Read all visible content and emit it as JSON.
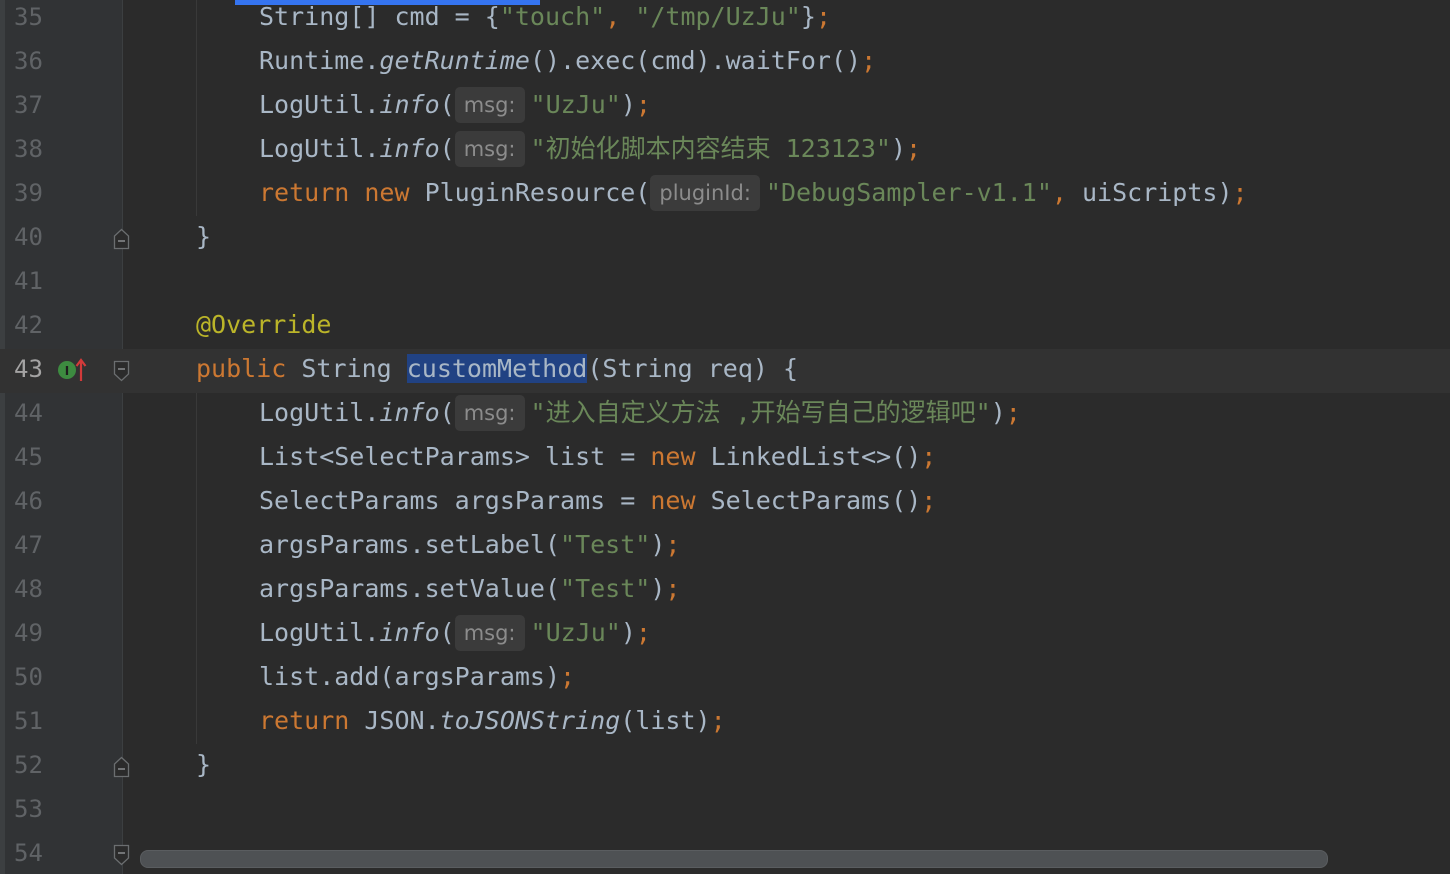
{
  "editor": {
    "theme_colors": {
      "background": "#2b2b2b",
      "gutter": "#313335",
      "keyword": "#cc7832",
      "string": "#6a8759",
      "annotation": "#bbb529",
      "default": "#a9b7c6",
      "selection": "#214283",
      "hint": "#8c8c8c"
    },
    "icons": {
      "implement_marker": "implements-interface-icon",
      "fold_marker": "fold-icon"
    },
    "lines": [
      {
        "num": "35",
        "tokens": [
          [
            "d",
            "String[] cmd = {"
          ],
          [
            "s",
            "\"touch\""
          ],
          [
            "p",
            ", "
          ],
          [
            "s",
            "\"/tmp/UzJu\""
          ],
          [
            "d",
            "}"
          ],
          [
            "p",
            ";"
          ]
        ]
      },
      {
        "num": "36",
        "tokens": [
          [
            "d",
            "Runtime."
          ],
          [
            "i",
            "getRuntime"
          ],
          [
            "d",
            "().exec(cmd).waitFor()"
          ],
          [
            "p",
            ";"
          ]
        ]
      },
      {
        "num": "37",
        "tokens": [
          [
            "d",
            "LogUtil."
          ],
          [
            "i",
            "info"
          ],
          [
            "d",
            "("
          ],
          [
            "h",
            "msg:"
          ],
          [
            "s",
            "\"UzJu\""
          ],
          [
            "d",
            ")"
          ],
          [
            "p",
            ";"
          ]
        ]
      },
      {
        "num": "38",
        "tokens": [
          [
            "d",
            "LogUtil."
          ],
          [
            "i",
            "info"
          ],
          [
            "d",
            "("
          ],
          [
            "h",
            "msg:"
          ],
          [
            "s",
            "\"初始化脚本内容结束 123123\""
          ],
          [
            "d",
            ")"
          ],
          [
            "p",
            ";"
          ]
        ]
      },
      {
        "num": "39",
        "tokens": [
          [
            "k",
            "return new "
          ],
          [
            "d",
            "PluginResource("
          ],
          [
            "h",
            "pluginId:"
          ],
          [
            "s",
            "\"DebugSampler-v1.1\""
          ],
          [
            "p",
            ", "
          ],
          [
            "d",
            "uiScripts)"
          ],
          [
            "p",
            ";"
          ]
        ]
      },
      {
        "num": "40",
        "tokens": [
          [
            "d",
            "}"
          ]
        ]
      },
      {
        "num": "41",
        "tokens": []
      },
      {
        "num": "42",
        "tokens": [
          [
            "a",
            "@Override"
          ]
        ]
      },
      {
        "num": "43",
        "tokens": [
          [
            "k",
            "public "
          ],
          [
            "d",
            "String "
          ],
          [
            "x",
            "customMethod"
          ],
          [
            "d",
            "(String req) {"
          ]
        ]
      },
      {
        "num": "44",
        "tokens": [
          [
            "d",
            "LogUtil."
          ],
          [
            "i",
            "info"
          ],
          [
            "d",
            "("
          ],
          [
            "h",
            "msg:"
          ],
          [
            "s",
            "\"进入自定义方法 ,开始写自己的逻辑吧\""
          ],
          [
            "d",
            ")"
          ],
          [
            "p",
            ";"
          ]
        ]
      },
      {
        "num": "45",
        "tokens": [
          [
            "d",
            "List<SelectParams> list = "
          ],
          [
            "k",
            "new "
          ],
          [
            "d",
            "LinkedList<>()"
          ],
          [
            "p",
            ";"
          ]
        ]
      },
      {
        "num": "46",
        "tokens": [
          [
            "d",
            "SelectParams argsParams = "
          ],
          [
            "k",
            "new "
          ],
          [
            "d",
            "SelectParams()"
          ],
          [
            "p",
            ";"
          ]
        ]
      },
      {
        "num": "47",
        "tokens": [
          [
            "d",
            "argsParams.setLabel("
          ],
          [
            "s",
            "\"Test\""
          ],
          [
            "d",
            ")"
          ],
          [
            "p",
            ";"
          ]
        ]
      },
      {
        "num": "48",
        "tokens": [
          [
            "d",
            "argsParams.setValue("
          ],
          [
            "s",
            "\"Test\""
          ],
          [
            "d",
            ")"
          ],
          [
            "p",
            ";"
          ]
        ]
      },
      {
        "num": "49",
        "tokens": [
          [
            "d",
            "LogUtil."
          ],
          [
            "i",
            "info"
          ],
          [
            "d",
            "("
          ],
          [
            "h",
            "msg:"
          ],
          [
            "s",
            "\"UzJu\""
          ],
          [
            "d",
            ")"
          ],
          [
            "p",
            ";"
          ]
        ]
      },
      {
        "num": "50",
        "tokens": [
          [
            "d",
            "list.add(argsParams)"
          ],
          [
            "p",
            ";"
          ]
        ]
      },
      {
        "num": "51",
        "tokens": [
          [
            "k",
            "return "
          ],
          [
            "d",
            "JSON."
          ],
          [
            "i",
            "toJSONString"
          ],
          [
            "d",
            "(list)"
          ],
          [
            "p",
            ";"
          ]
        ]
      },
      {
        "num": "52",
        "tokens": [
          [
            "d",
            "}"
          ]
        ]
      },
      {
        "num": "53",
        "tokens": []
      },
      {
        "num": "54",
        "tokens": []
      }
    ]
  }
}
